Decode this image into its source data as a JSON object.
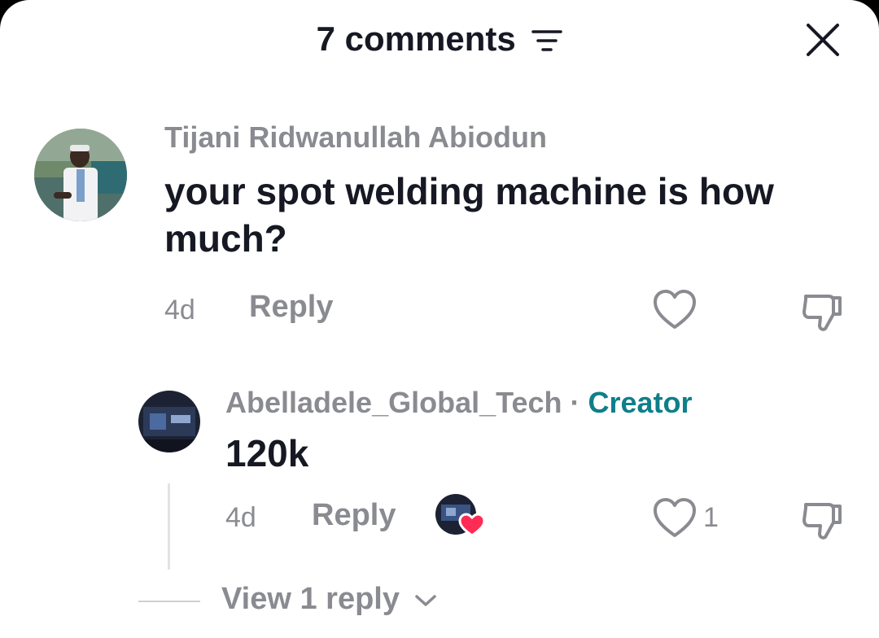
{
  "header": {
    "title": "7 comments",
    "sort_icon": "sort-lines-icon",
    "close_icon": "close-icon"
  },
  "comments": [
    {
      "author": "Tijani Ridwanullah Abiodun",
      "text": "your spot welding machine is how much?",
      "time": "4d",
      "reply_label": "Reply",
      "like_icon": "heart-outline-icon",
      "dislike_icon": "thumbs-down-icon"
    }
  ],
  "reply": {
    "author": "Abelladele_Global_Tech",
    "separator": "·",
    "badge": "Creator",
    "text": "120k",
    "time": "4d",
    "reply_label": "Reply",
    "likes": "1",
    "creator_liked_icon": "creator-liked-heart-icon",
    "like_icon": "heart-outline-icon",
    "dislike_icon": "thumbs-down-icon"
  },
  "view_replies": {
    "label": "View 1 reply",
    "icon": "chevron-down-icon"
  },
  "colors": {
    "text_primary": "#161823",
    "text_secondary": "#8a8b91",
    "creator": "#0e7f8a",
    "heart_red": "#fe2c55"
  }
}
